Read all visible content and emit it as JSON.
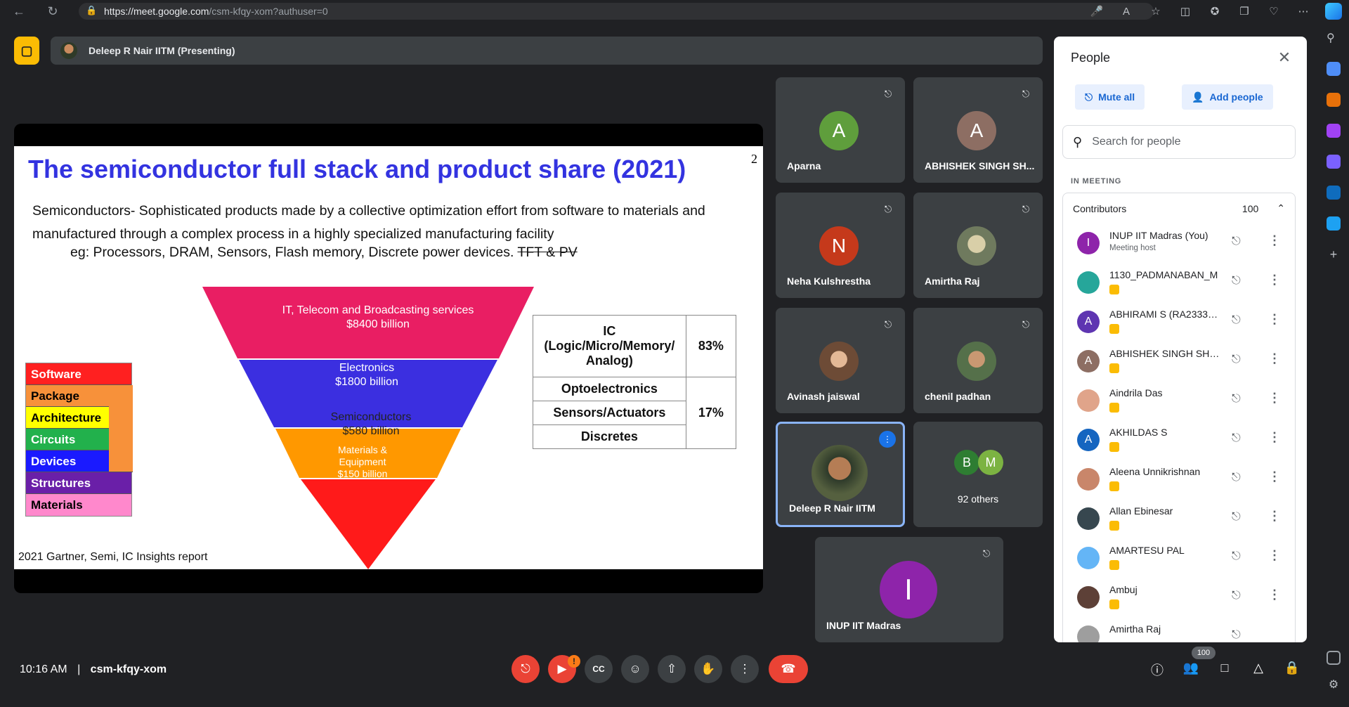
{
  "browser": {
    "url_host": "https://meet.google.com",
    "url_path": "/csm-kfqy-xom?authuser=0"
  },
  "top": {
    "presenter_label": "Deleep R Nair IITM (Presenting)"
  },
  "slide": {
    "title": "The semiconductor full stack and product share (2021)",
    "page_number": "2",
    "body_line1": "Semiconductors- Sophisticated products made by a collective optimization effort from software to materials and",
    "body_line2": "manufactured through a complex process in a highly specialized manufacturing facility",
    "example_prefix": "eg: Processors, DRAM, Sensors, Flash memory, Discrete power devices. ",
    "example_strike": "TFT & PV",
    "stack_layers": [
      "Software",
      "Package",
      "Architecture",
      "Circuits",
      "Devices",
      "Structures",
      "Materials"
    ],
    "pyramid": [
      {
        "label": "IT, Telecom and Broadcasting services",
        "value": "$8400 billion"
      },
      {
        "label": "Electronics",
        "value": "$1800 billion"
      },
      {
        "label": "Semiconductors",
        "value": "$580 billion"
      },
      {
        "label": "Materials & Equipment",
        "value": "$150 billion"
      }
    ],
    "table": {
      "ic": "IC (Logic/Micro/Memory/ Analog)",
      "ic_share": "83%",
      "opto": "Optoelectronics",
      "sensors": "Sensors/Actuators",
      "discretes": "Discretes",
      "other_share": "17%"
    },
    "source": "2021 Gartner, Semi, IC Insights report"
  },
  "tiles": [
    {
      "name": "Aparna",
      "initial": "A",
      "color": "#5f9e3c"
    },
    {
      "name": "ABHISHEK SINGH SH...",
      "initial": "A",
      "color": "#8d6e63"
    },
    {
      "name": "Neha Kulshrestha",
      "initial": "N",
      "color": "#c5391b"
    },
    {
      "name": "Amirtha Raj",
      "initial": "",
      "color": "#8a8f7a"
    },
    {
      "name": "Avinash jaiswal",
      "initial": "",
      "color": "#7a5b47"
    },
    {
      "name": "chenil padhan",
      "initial": "",
      "color": "#6f8060"
    },
    {
      "name": "Deleep R Nair IITM",
      "initial": "",
      "color": "#6b7457"
    },
    {
      "name": "92 others",
      "initial_b": "B",
      "initial_m": "M"
    },
    {
      "name": "INUP IIT Madras",
      "initial": "I",
      "color": "#8e24aa"
    }
  ],
  "people": {
    "title": "People",
    "mute_all": "Mute all",
    "add_people": "Add people",
    "search_placeholder": "Search for people",
    "in_meeting": "IN MEETING",
    "contributors": "Contributors",
    "contributors_count": "100",
    "list": [
      {
        "name": "INUP IIT Madras (You)",
        "sub": "Meeting host",
        "initial": "I",
        "color": "#8e24aa"
      },
      {
        "name": "1130_PADMANABAN_M",
        "initial": "",
        "color": "#26a69a"
      },
      {
        "name": "ABHIRAMI S (RA233300...",
        "initial": "A",
        "color": "#5e35b1"
      },
      {
        "name": "ABHISHEK SINGH SHEK...",
        "initial": "A",
        "color": "#8d6e63"
      },
      {
        "name": "Aindrila Das",
        "initial": "",
        "color": "#e0a48a"
      },
      {
        "name": "AKHILDAS S",
        "initial": "A",
        "color": "#1565c0"
      },
      {
        "name": "Aleena Unnikrishnan",
        "initial": "",
        "color": "#c9866a"
      },
      {
        "name": "Allan Ebinesar",
        "initial": "",
        "color": "#37474f"
      },
      {
        "name": "AMARTESU PAL",
        "initial": "",
        "color": "#64b5f6"
      },
      {
        "name": "Ambuj",
        "initial": "",
        "color": "#5d4037"
      },
      {
        "name": "Amirtha Raj",
        "initial": "",
        "color": "#9e9e9e"
      }
    ]
  },
  "bottom": {
    "time": "10:16 AM",
    "meeting_code": "csm-kfqy-xom",
    "people_count": "100"
  }
}
